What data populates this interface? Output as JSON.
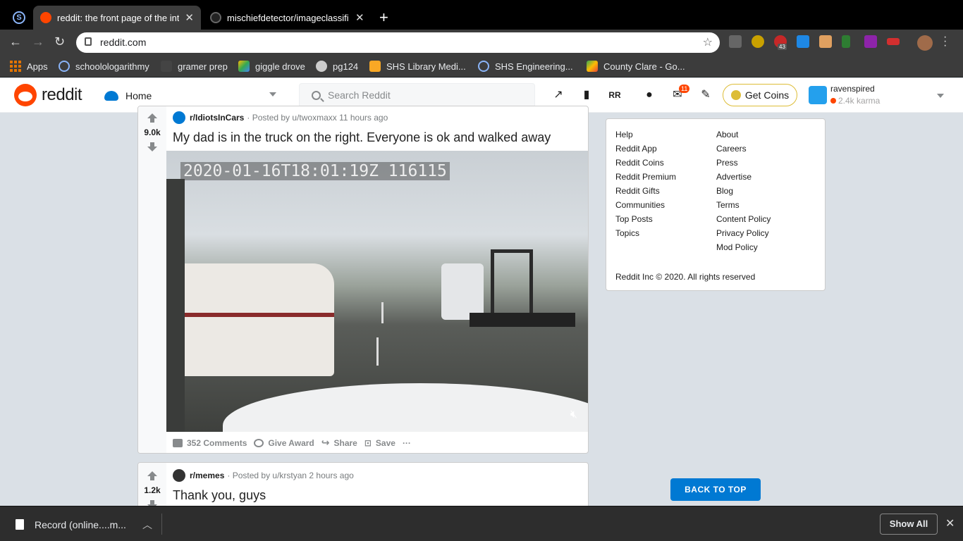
{
  "browser": {
    "tabs": [
      {
        "title": "reddit: the front page of the int",
        "active": true
      },
      {
        "title": "mischiefdetector/imageclassifi",
        "active": false
      }
    ],
    "url": "reddit.com",
    "bookmarks": [
      "Apps",
      "schoolologarithmy",
      "gramer prep",
      "giggle drove",
      "pg124",
      "SHS Library Medi...",
      "SHS Engineering...",
      "County Clare - Go..."
    ],
    "extension_badge": "43"
  },
  "reddit": {
    "wordmark": "reddit",
    "feed_selector": "Home",
    "search_placeholder": "Search Reddit",
    "mail_count": "11",
    "get_coins": "Get Coins",
    "username": "ravenspired",
    "karma": "2.4k karma"
  },
  "posts": [
    {
      "votes": "9.0k",
      "subreddit": "r/IdiotsInCars",
      "meta": "· Posted by u/twoxmaxx 11 hours ago",
      "title": "My dad is in the truck on the right. Everyone is ok and walked away",
      "timestamp_overlay": "2020-01-16T18:01:19Z 116115",
      "actions": {
        "comments": "352 Comments",
        "award": "Give Award",
        "share": "Share",
        "save": "Save",
        "more": "···"
      }
    },
    {
      "votes": "1.2k",
      "subreddit": "r/memes",
      "meta": "· Posted by u/krstyan 2 hours ago",
      "title": "Thank you, guys"
    }
  ],
  "sidebar": {
    "col1": [
      "Help",
      "Reddit App",
      "Reddit Coins",
      "Reddit Premium",
      "Reddit Gifts",
      "Communities",
      "Top Posts",
      "Topics"
    ],
    "col2": [
      "About",
      "Careers",
      "Press",
      "Advertise",
      "Blog",
      "Terms",
      "Content Policy",
      "Privacy Policy",
      "Mod Policy"
    ],
    "copyright": "Reddit Inc © 2020. All rights reserved"
  },
  "back_to_top": "BACK TO TOP",
  "downloads": {
    "file": "Record (online....m...",
    "show_all": "Show All"
  },
  "colors": {
    "reddit_orange": "#ff4500",
    "reddit_blue": "#0079d3",
    "coins_gold": "#ddbd37"
  }
}
